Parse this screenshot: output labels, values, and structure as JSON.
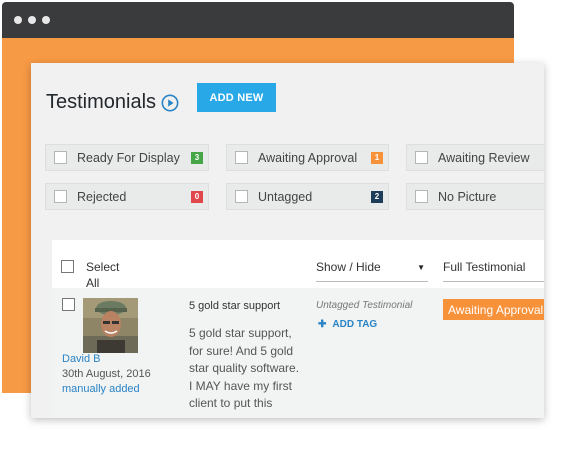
{
  "header": {
    "title": "Testimonials",
    "add_new_label": "ADD NEW"
  },
  "filters": [
    {
      "label": "Ready For Display",
      "count": "3",
      "color": "#46a546"
    },
    {
      "label": "Awaiting Approval",
      "count": "1",
      "color": "#f7913a"
    },
    {
      "label": "Awaiting Review",
      "count": "",
      "color": ""
    },
    {
      "label": "Rejected",
      "count": "0",
      "color": "#e0474c"
    },
    {
      "label": "Untagged",
      "count": "2",
      "color": "#1d3d5a"
    },
    {
      "label": "No Picture",
      "count": "",
      "color": ""
    }
  ],
  "table": {
    "select_all_label": "Select All",
    "show_hide_label": "Show / Hide",
    "view_label": "Full Testimonial"
  },
  "row": {
    "author_name": "David B",
    "date": "30th August, 2016",
    "source": "manually added",
    "title": "5 gold star support",
    "body": "5 gold star support, for sure! And 5 gold star quality software. I MAY have my first client to put this",
    "tag_status": "Untagged Testimonial",
    "add_tag_label": "ADD TAG",
    "status_label": "Awaiting Approval"
  },
  "colors": {
    "accent": "#29a8e8",
    "orange": "#f79a45",
    "status_orange": "#f7913a"
  }
}
